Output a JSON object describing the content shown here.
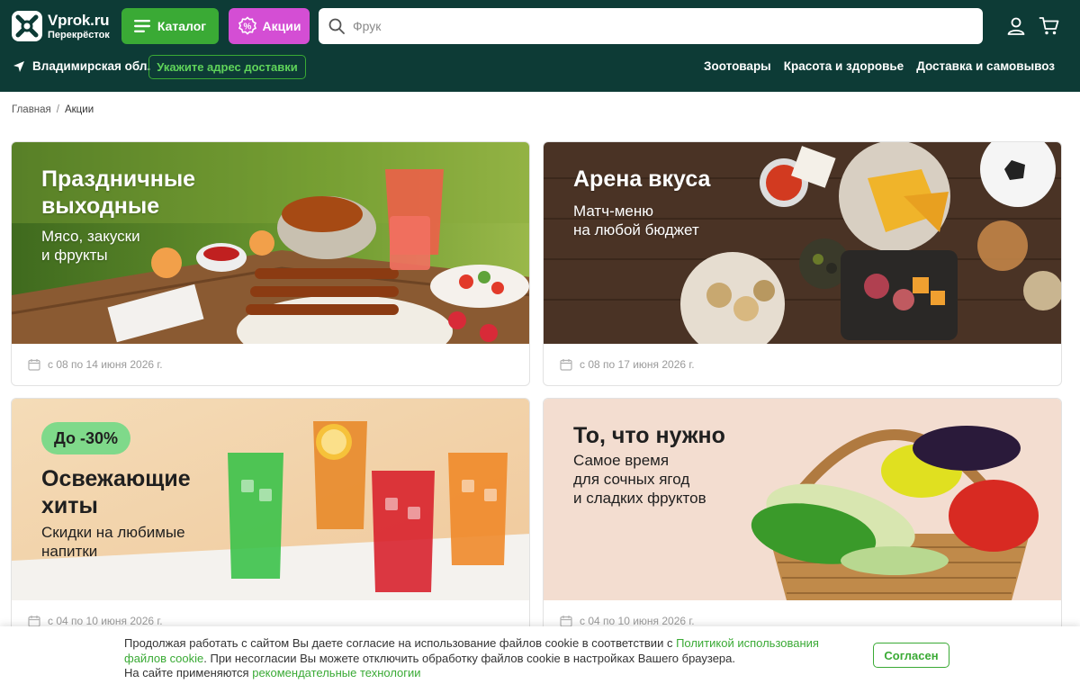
{
  "header": {
    "logo": {
      "name": "Vprok.ru",
      "sub": "Перекрёсток"
    },
    "catalog_label": "Каталог",
    "promo_label": "Акции",
    "search": {
      "value": "",
      "placeholder": "Фрук"
    },
    "region": "Владимирская обл.",
    "address_button": "Укажите адрес доставки",
    "links": [
      "Зоотовары",
      "Красота и здоровье",
      "Доставка и самовывоз"
    ],
    "colors": {
      "bg": "#0d3b36",
      "green": "#3aaa35",
      "promo": "#d44ed4"
    }
  },
  "breadcrumb": {
    "home": "Главная",
    "separator": "/",
    "current": "Акции"
  },
  "promos": [
    {
      "title_lines": [
        "Праздничные",
        "выходные"
      ],
      "subtitle_lines": [
        "Мясо, закуски",
        "и фрукты"
      ],
      "dates": "с 08 по 14 июня 2026 г.",
      "badge": ""
    },
    {
      "title_lines": [
        "Арена вкуса"
      ],
      "subtitle_lines": [
        "Матч-меню",
        "на любой бюджет"
      ],
      "dates": "с 08 по 17 июня 2026 г.",
      "badge": ""
    },
    {
      "title_lines": [
        "Освежающие",
        "хиты"
      ],
      "subtitle_lines": [
        "Скидки на любимые",
        "напитки"
      ],
      "dates": "с 04 по 10 июня 2026 г.",
      "badge": "До -30%"
    },
    {
      "title_lines": [
        "То, что нужно"
      ],
      "subtitle_lines": [
        "Самое время",
        "для сочных ягод",
        "и сладких фруктов"
      ],
      "dates": "с 04 по 10 июня 2026 г.",
      "badge": ""
    }
  ],
  "cookie": {
    "text1": "Продолжая работать с сайтом Вы даете согласие на использование файлов cookie в соответствии с ",
    "link1a": "Политикой использования",
    "link1b": "файлов cookie",
    "text2": ". При несогласии Вы можете отключить обработку файлов cookie в настройках Вашего браузера.",
    "text3": "На сайте применяются ",
    "link2": "рекомендательные технологии",
    "button": "Согласен"
  },
  "icons": [
    "logo-icon",
    "menu-icon",
    "percent-icon",
    "search-icon",
    "user-icon",
    "cart-icon",
    "location-arrow-icon",
    "calendar-icon"
  ]
}
